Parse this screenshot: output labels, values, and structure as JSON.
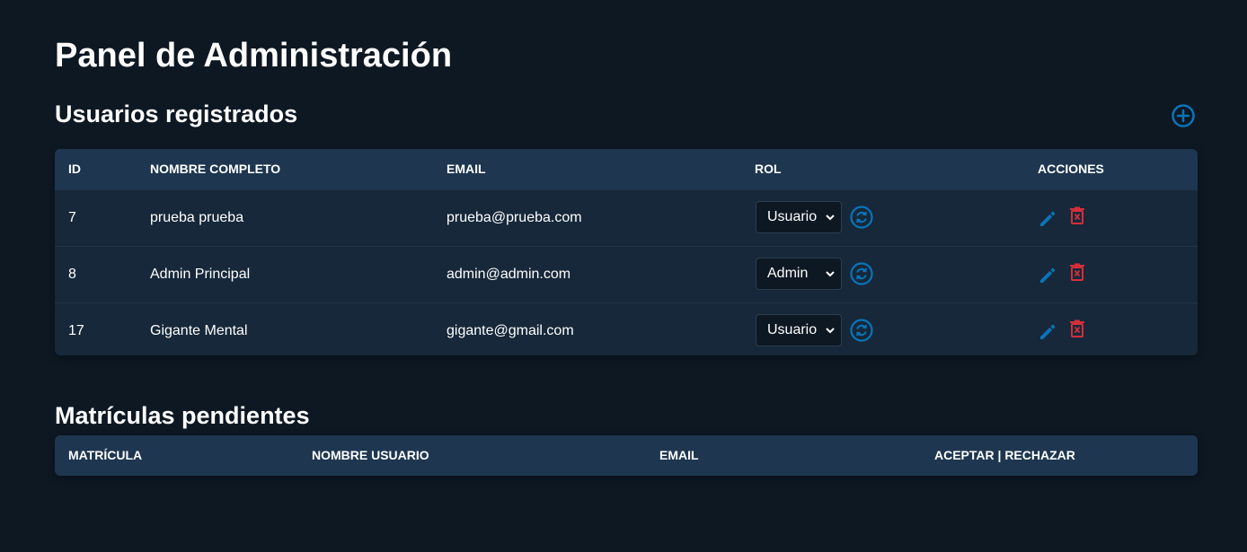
{
  "page": {
    "title": "Panel de Administración"
  },
  "users_section": {
    "title": "Usuarios registrados",
    "add_icon": "plus-circle-icon",
    "columns": [
      "ID",
      "NOMBRE COMPLETO",
      "EMAIL",
      "ROL",
      "ACCIONES"
    ],
    "rows": [
      {
        "id": "7",
        "name": "prueba prueba",
        "email": "prueba@prueba.com",
        "role": "Usuario"
      },
      {
        "id": "8",
        "name": "Admin Principal",
        "email": "admin@admin.com",
        "role": "Admin"
      },
      {
        "id": "17",
        "name": "Gigante Mental",
        "email": "gigante@gmail.com",
        "role": "Usuario"
      }
    ],
    "row_icons": {
      "change_role": "refresh-icon",
      "edit": "pencil-icon",
      "delete": "trash-icon"
    }
  },
  "enrollments_section": {
    "title": "Matrículas pendientes",
    "columns": [
      "MATRÍCULA",
      "NOMBRE USUARIO",
      "EMAIL",
      "ACEPTAR | RECHAZAR"
    ]
  },
  "colors": {
    "background": "#0d1823",
    "table_body": "#16283a",
    "table_header": "#1e3650",
    "accent_blue": "#0a74b8",
    "danger_red": "#d32f3a"
  }
}
